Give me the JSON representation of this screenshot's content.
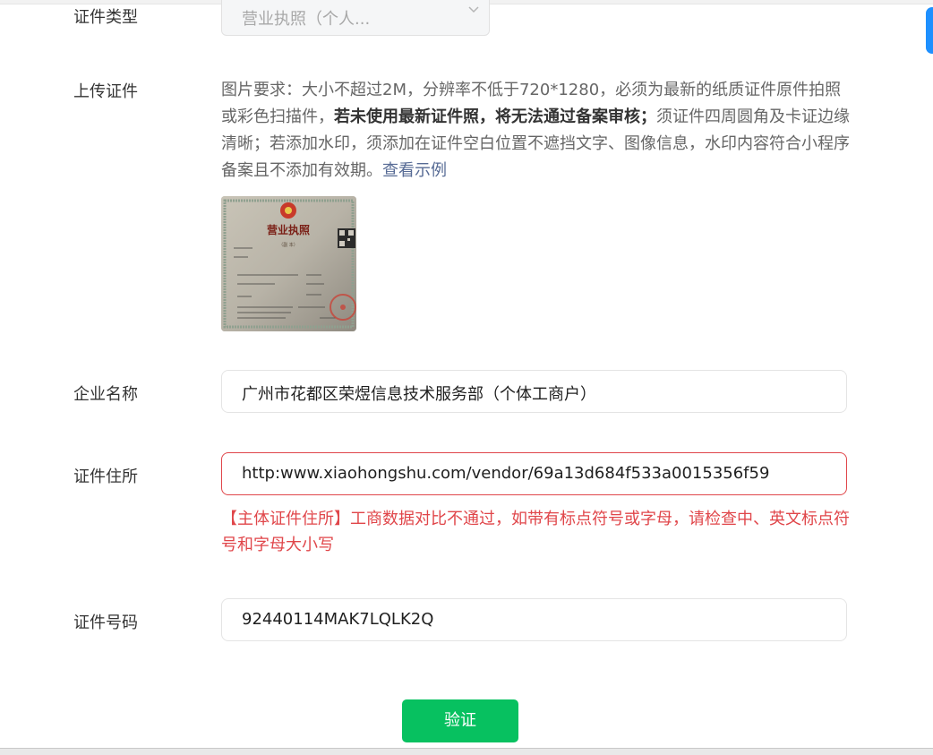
{
  "form": {
    "cert_type": {
      "label": "证件类型",
      "value": "营业执照（个人..."
    },
    "upload": {
      "label": "上传证件",
      "req_part1": "图片要求：大小不超过2M，分辨率不低于720*1280，必须为最新的纸质证件原件拍照或彩色扫描件，",
      "req_bold": "若未使用最新证件照，将无法通过备案审核；",
      "req_part2": "须证件四周圆角及卡证边缘清晰；若添加水印，须添加在证件空白位置不遮挡文字、图像信息，水印内容符合小程序备案且不添加有效期。",
      "example_link": "查看示例",
      "license_image": {
        "title": "营业执照",
        "subtitle": "（副 本）"
      }
    },
    "company_name": {
      "label": "企业名称",
      "value": "广州市花都区荣煜信息技术服务部（个体工商户）"
    },
    "cert_address": {
      "label": "证件住所",
      "value": "http:www.xiaohongshu.com/vendor/69a13d684f533a0015356f59",
      "error": "【主体证件住所】工商数据对比不通过，如带有标点符号或字母，请检查中、英文标点符号和字母大小写"
    },
    "cert_number": {
      "label": "证件号码",
      "value": "92440114MAK7LQLK2Q"
    },
    "verify_button": "验证"
  },
  "colors": {
    "primary_green": "#07c160",
    "error_red": "#e0464a",
    "link_blue": "#576b95",
    "side_tab_blue": "#1e90ff"
  },
  "icons": [
    "chevron-down-icon",
    "national-emblem-icon",
    "qr-code-icon",
    "red-seal-icon"
  ]
}
